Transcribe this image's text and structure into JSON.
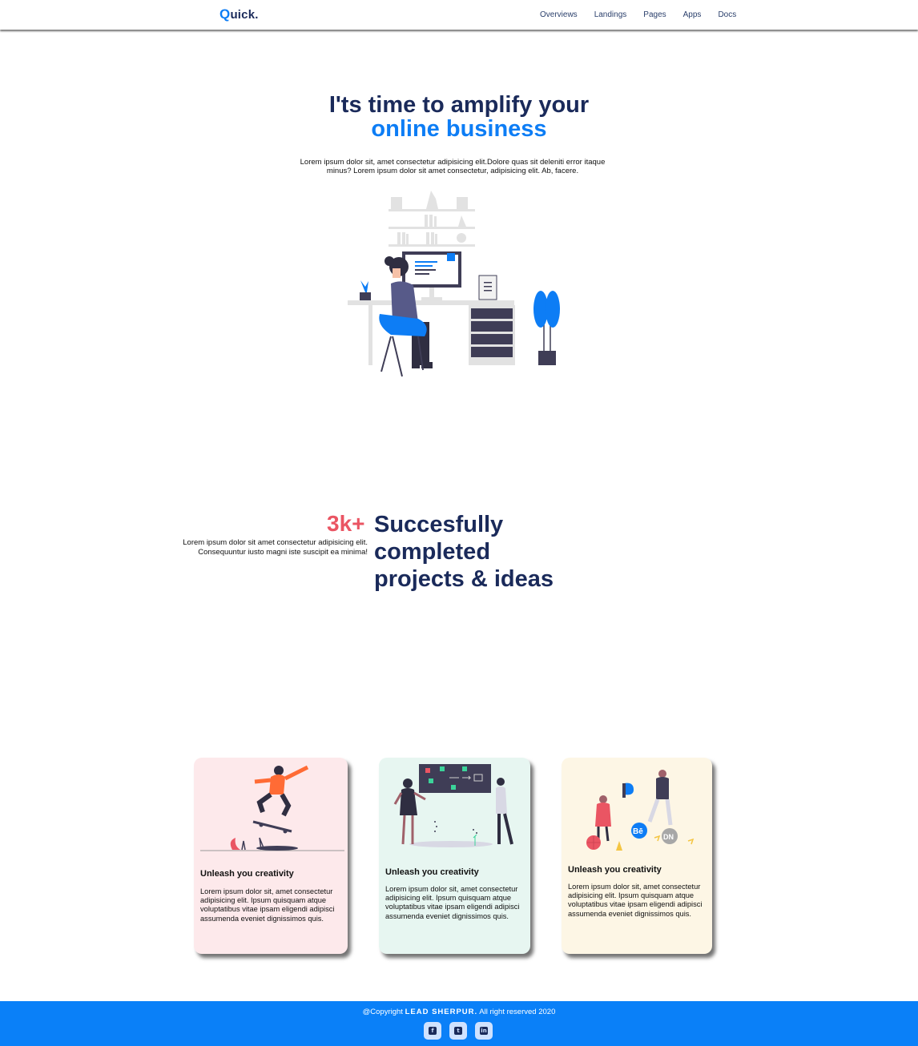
{
  "nav": {
    "logo_initial": "Q",
    "logo_rest": "uick.",
    "items": [
      {
        "label": "Overviews"
      },
      {
        "label": "Landings"
      },
      {
        "label": "Pages"
      },
      {
        "label": "Apps"
      },
      {
        "label": "Docs"
      }
    ]
  },
  "hero": {
    "title_line1": "I'ts time to amplify your",
    "title_line2": "online business",
    "description": "Lorem ipsum dolor sit, amet consectetur adipisicing elit.Dolore quas sit deleniti error itaque minus? Lorem ipsum dolor sit amet consectetur, adipisicing elit. Ab, facere."
  },
  "stats": {
    "number": "3k+",
    "description": "Lorem ipsum dolor sit amet consectetur adipisicing elit. Consequuntur iusto magni iste suscipit ea minima!",
    "title": "Succesfully completed projects & ideas"
  },
  "cards": [
    {
      "title": "Unleash you creativity",
      "text": "Lorem ipsum dolor sit, amet consectetur adipisicing elit. Ipsum quisquam atque voluptatibus vitae ipsam eligendi adipisci assumenda eveniet dignissimos quis."
    },
    {
      "title": "Unleash you creativity",
      "text": "Lorem ipsum dolor sit, amet consectetur adipisicing elit. Ipsum quisquam atque voluptatibus vitae ipsam eligendi adipisci assumenda eveniet dignissimos quis."
    },
    {
      "title": "Unleash you creativity",
      "text": "Lorem ipsum dolor sit, amet consectetur adipisicing elit. Ipsum quisquam atque voluptatibus vitae ipsam eligendi adipisci assumenda eveniet dignissimos quis."
    }
  ],
  "footer": {
    "copyright_prefix": "@Copyright",
    "brand": "LEAD SHERPUR.",
    "copyright_suffix": "All right reserved 2020",
    "socials": [
      {
        "icon": "facebook-icon",
        "glyph": "f"
      },
      {
        "icon": "twitter-icon",
        "glyph": "t"
      },
      {
        "icon": "linkedin-icon",
        "glyph": "in"
      }
    ]
  },
  "colors": {
    "primary": "#0d7df5",
    "navy": "#1a2a5a",
    "accent_red": "#ea5563",
    "footer_bg": "#0a80f8"
  }
}
